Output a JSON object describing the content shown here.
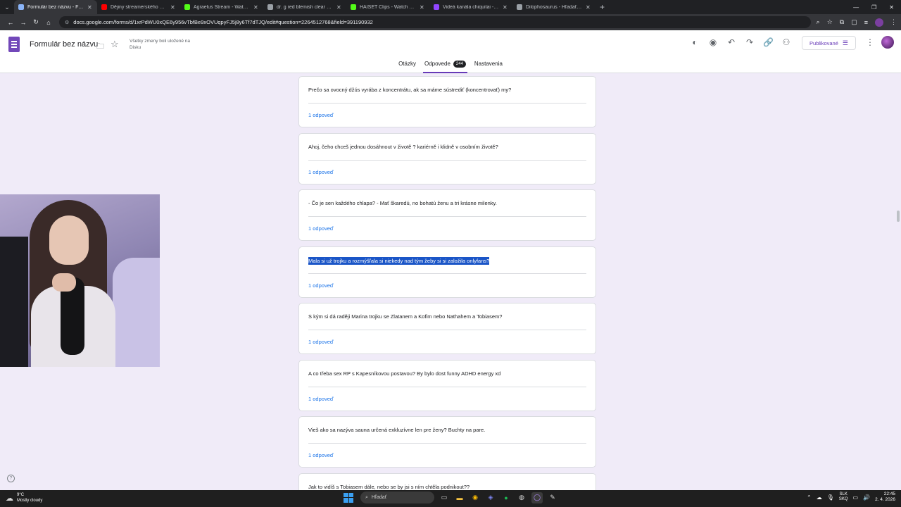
{
  "browser": {
    "tabs": [
      {
        "title": "Formulár bez názvu - Formulár",
        "fav_color": "#8ab4f8",
        "active": true
      },
      {
        "title": "Dějiny streamerského národa",
        "fav_color": "#ff0000",
        "active": false
      },
      {
        "title": "Agraelus Stream - Watch Live o",
        "fav_color": "#53fc18",
        "active": false
      },
      {
        "title": "dr. g red blemish clear soothin",
        "fav_color": "#9aa0a6",
        "active": false
      },
      {
        "title": "HAISET Clips - Watch Live on K",
        "fav_color": "#53fc18",
        "active": false
      },
      {
        "title": "Videá kanála chiquitai - Twitch",
        "fav_color": "#9146ff",
        "active": false
      },
      {
        "title": "Dilophosaurus - Hľadať Googl",
        "fav_color": "#9aa0a6",
        "active": false
      }
    ],
    "url": "docs.google.com/forms/d/1xrPdWU0xQE6y956vTbfBe9xOVUqpyFJ5j8y6Tf7dTJQ/edit#question=2264512768&field=391190932"
  },
  "form": {
    "title": "Formulár bez názvu",
    "save_status": "Všetky zmeny boli uložené na Disku",
    "publish_label": "Publikované",
    "tabs": {
      "questions": "Otázky",
      "responses": "Odpovede",
      "responses_count": "244",
      "settings": "Nastavenia"
    }
  },
  "responses": [
    {
      "question": "Prečo sa ovocný džús vyrába z koncentrátu, ak sa máme sústrediť (koncentrovať) my?",
      "link": "1 odpoveď",
      "selected": false
    },
    {
      "question": "Ahoj, čeho chceš jednou dosáhnout v životě ? kariérně i klidně v osobním životě?",
      "link": "1 odpoveď",
      "selected": false
    },
    {
      "question": "- Čo je sen každého chlapa? - Mať škaredú, no bohatú ženu a tri krásne milenky.",
      "link": "1 odpoveď",
      "selected": false
    },
    {
      "question": "Mala si už trojku a rozmýšľala si niekedy nad tým žeby si si založila onlyfans?",
      "link": "1 odpoveď",
      "selected": true
    },
    {
      "question": "S kým si dá raději Marina trojku se Zlatanem a Kofim nebo Nathahem a Tobiasem?",
      "link": "1 odpoveď",
      "selected": false
    },
    {
      "question": "A co třeba sex RP s Kapesníkovou postavou? By bylo dost funny ADHD energy xd",
      "link": "1 odpoveď",
      "selected": false
    },
    {
      "question": "Vieš ako sa nazýva sauna určená exkluzívne len pre ženy? Buchty na pare.",
      "link": "1 odpoveď",
      "selected": false
    },
    {
      "question": "Jak to vidíš s Tobiasem dále, nebo se by jsi s ním chtěla podnikout??",
      "link": "",
      "selected": false
    }
  ],
  "taskbar": {
    "weather_temp": "9°C",
    "weather_desc": "Mostly cloudy",
    "search_placeholder": "Hľadať",
    "lang_1": "SLK",
    "lang_2": "SKQ",
    "time": "22:45",
    "date": "2. 4. 2026"
  }
}
